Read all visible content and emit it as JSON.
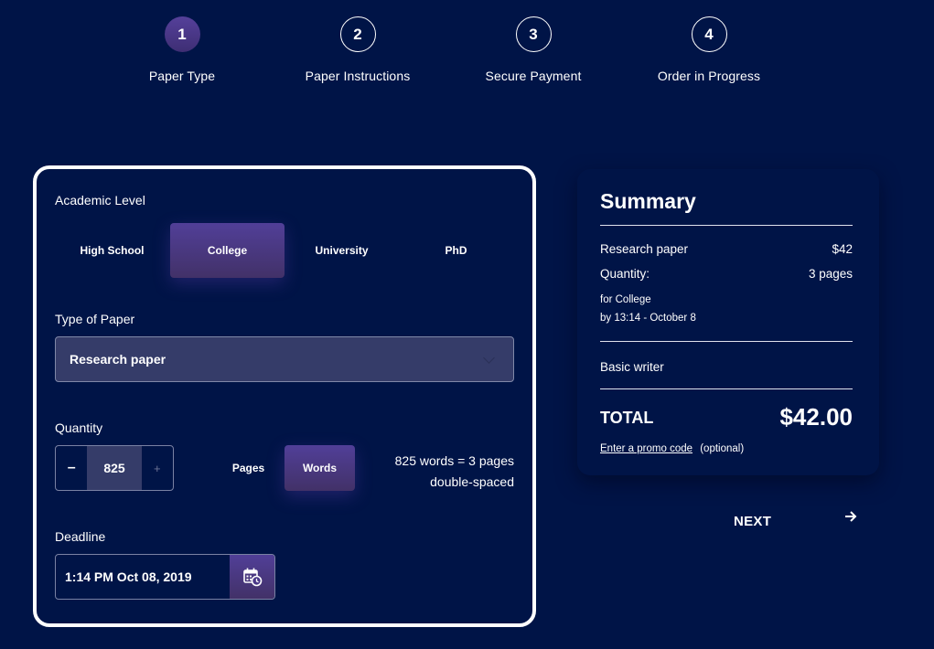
{
  "stepper": {
    "steps": [
      {
        "number": "1",
        "label": "Paper Type",
        "active": true
      },
      {
        "number": "2",
        "label": "Paper Instructions",
        "active": false
      },
      {
        "number": "3",
        "label": "Secure Payment",
        "active": false
      },
      {
        "number": "4",
        "label": "Order in Progress",
        "active": false
      }
    ]
  },
  "form": {
    "academic_level": {
      "label": "Academic Level",
      "options": [
        "High School",
        "College",
        "University",
        "PhD"
      ],
      "selected": "College"
    },
    "paper_type": {
      "label": "Type of Paper",
      "value": "Research paper",
      "icon": "chevron-down-icon"
    },
    "quantity": {
      "label": "Quantity",
      "minus_label": "–",
      "plus_label": "+",
      "value": "825",
      "units": [
        "Pages",
        "Words"
      ],
      "selected_unit": "Words",
      "conversion_line1": "825 words = 3 pages",
      "conversion_line2": "double-spaced"
    },
    "deadline": {
      "label": "Deadline",
      "value": "1:14 PM Oct 08, 2019",
      "icon": "calendar-clock-icon"
    }
  },
  "summary": {
    "title": "Summary",
    "paper_label": "Research paper",
    "paper_price": "$42",
    "quantity_label": "Quantity:",
    "quantity_value": "3 pages",
    "level_note": "for College",
    "deadline_note": "by 13:14 - October 8",
    "writer": "Basic writer",
    "total_label": "TOTAL",
    "total_value": "$42.00",
    "promo_link": "Enter a promo code",
    "promo_note": "(optional)"
  },
  "next_button": {
    "label": "NEXT",
    "icon": "arrow-right-icon"
  },
  "colors": {
    "background": "#001447",
    "accent": "#513f98",
    "field_bg": "#353c69"
  }
}
